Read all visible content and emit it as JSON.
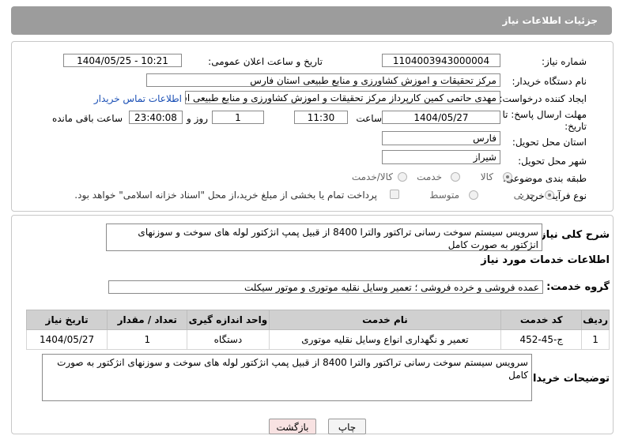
{
  "header": {
    "title": "جزئیات اطلاعات نیاز"
  },
  "form": {
    "need_number_label": "شماره نیاز:",
    "need_number": "1104003943000004",
    "announce_label": "تاریخ و ساعت اعلان عمومی:",
    "announce_value": "1404/05/25 - 10:21",
    "buyer_org_label": "نام دستگاه خریدار:",
    "buyer_org": "مرکز تحقیقات و اموزش کشاورزی و منابع طبیعی استان فارس",
    "requester_label": "ایجاد کننده درخواست:",
    "requester": "مهدی حاتمی کمین کارپرداز  مرکز تحقیقات و اموزش کشاورزی و منابع طبیعی استان فارس",
    "contact_link": "اطلاعات تماس خریدار",
    "deadline_label_1": "مهلت ارسال پاسخ: تا",
    "deadline_label_2": "تاریخ:",
    "deadline_date": "1404/05/27",
    "time_label": "ساعت",
    "deadline_time": "11:30",
    "days_value": "1",
    "days_label": "روز و",
    "remaining_time": "23:40:08",
    "remaining_label": "ساعت باقی مانده",
    "province_label": "استان محل تحویل:",
    "province": "فارس",
    "city_label": "شهر محل تحویل:",
    "city": "شیراز",
    "category_label": "طبقه بندی موضوعی:",
    "category_options": [
      "کالا",
      "خدمت",
      "کالا/خدمت"
    ],
    "process_label": "نوع فرآیند خرید :",
    "process_options": [
      "جزیی",
      "متوسط"
    ],
    "payment_note": "پرداخت تمام یا بخشی از مبلغ خرید،از محل \"اسناد خزانه اسلامی\" خواهد بود."
  },
  "summary": {
    "label": "شرح کلی نیاز:",
    "text": "سرویس سیستم سوخت رسانی تراکتور والترا 8400 از قبیل پمپ انژکتور لوله های سوخت و سوزنهای انژکتور به صورت کامل"
  },
  "services": {
    "section_title": "اطلاعات خدمات مورد نیاز",
    "group_label": "گروه خدمت:",
    "group_value": "عمده فروشی و خرده فروشی ؛ تعمیر وسایل نقلیه موتوری و موتور سیکلت",
    "columns": [
      "ردیف",
      "کد خدمت",
      "نام خدمت",
      "واحد اندازه گیری",
      "تعداد / مقدار",
      "تاریخ نیاز"
    ],
    "rows": [
      [
        "1",
        "ج-45-452",
        "تعمیر و نگهداری انواع وسایل نقلیه موتوری",
        "دستگاه",
        "1",
        "1404/05/27"
      ]
    ]
  },
  "buyer_notes": {
    "label": "توضیحات خریدار:",
    "text": "سرویس سیستم سوخت رسانی تراکتور والترا 8400 از قبیل پمپ انژکتور لوله های سوخت و سوزنهای انژکتور به صورت کامل"
  },
  "buttons": {
    "print": "چاپ",
    "back": "بازگشت"
  },
  "colors": {
    "header_bg": "#9c9c9c",
    "link": "#1a4fb5",
    "back_button_bg": "#f8e2e2",
    "table_header_bg": "#d0d0d0",
    "watermark": "#e9b8b8"
  }
}
